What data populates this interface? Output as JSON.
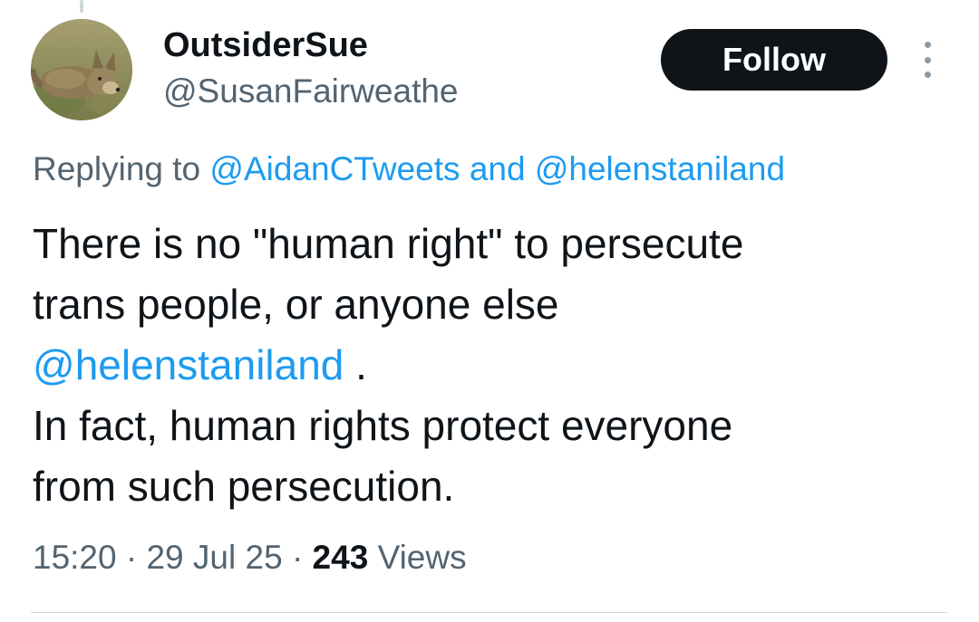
{
  "author": {
    "display_name": "OutsiderSue",
    "handle": "@SusanFairweathe"
  },
  "follow_button": {
    "label": "Follow"
  },
  "more_button": {
    "icon": "more-vertical-icon"
  },
  "reply_context": {
    "prefix": "Replying to",
    "mention_1": "@AidanCTweets",
    "conjunction": "and",
    "mention_2": "@helenstaniland"
  },
  "tweet": {
    "line_1": "There is no \"human right\" to persecute",
    "line_2": "trans people, or anyone else",
    "mention": "@helenstaniland",
    "mention_suffix": " .",
    "line_4": "In fact, human rights protect everyone",
    "line_5": "from such persecution."
  },
  "meta": {
    "time": "15:20",
    "separator": "·",
    "date": "29 Jul 25",
    "views_count": "243",
    "views_label": "Views"
  },
  "colors": {
    "text_primary": "#0f1419",
    "text_secondary": "#536471",
    "link": "#1d9bf0",
    "follow_bg": "#0f1419",
    "divider": "#cfd9de"
  }
}
